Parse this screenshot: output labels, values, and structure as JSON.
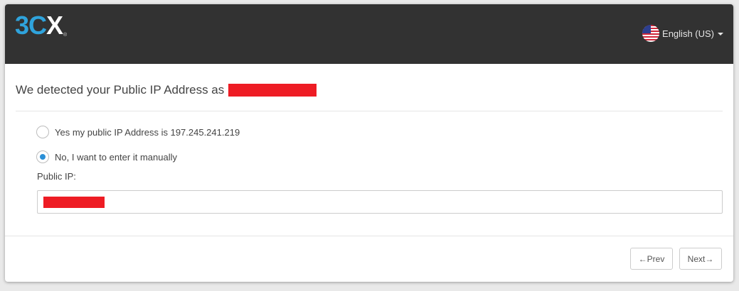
{
  "header": {
    "logo": {
      "part1": "3",
      "part2": "C",
      "part3": "X",
      "registered": "®"
    },
    "language": {
      "label": "English (US)",
      "flag_icon": "us-flag-icon"
    }
  },
  "main": {
    "title": "We detected your Public IP Address as",
    "options": [
      {
        "label": "Yes my public IP Address is 197.245.241.219",
        "checked": false
      },
      {
        "label": "No, I want to enter it manually",
        "checked": true
      }
    ],
    "public_ip_label": "Public IP:"
  },
  "footer": {
    "prev_label": "←Prev",
    "next_label": "Next→"
  },
  "colors": {
    "header_bg": "#323232",
    "brand_blue": "#2fa3dc",
    "radio_checked": "#2a8fd6",
    "redaction": "#ee1c24"
  }
}
